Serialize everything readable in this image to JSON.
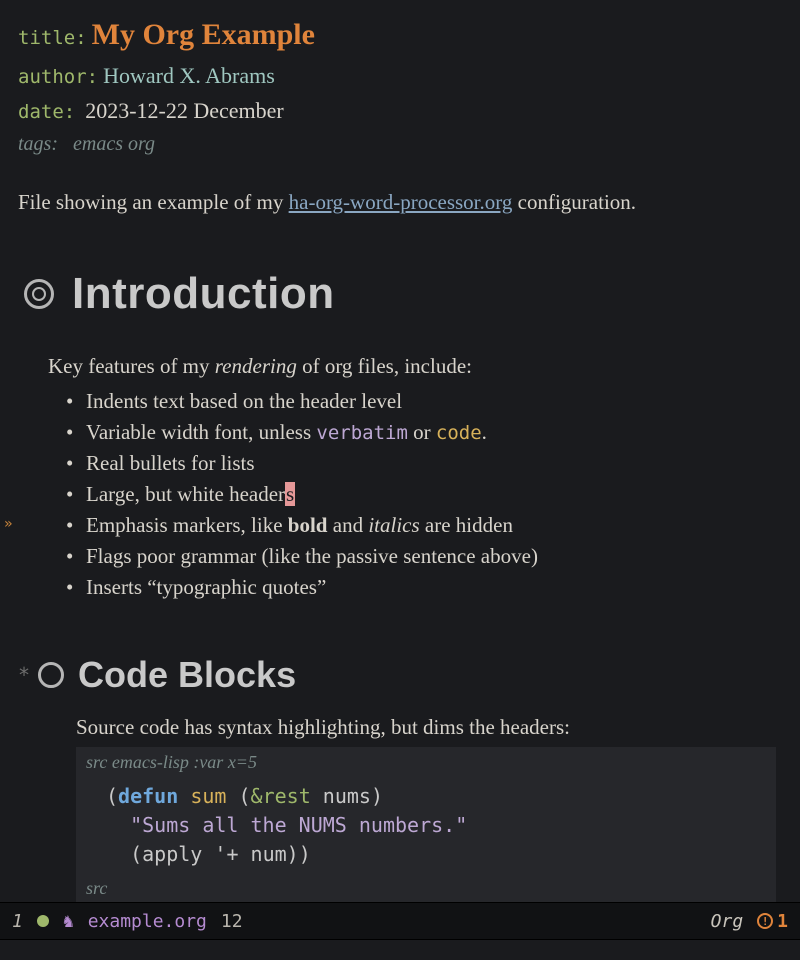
{
  "meta": {
    "title_key": "title",
    "title_val": "My Org Example",
    "author_key": "author",
    "author_val": "Howard X. Abrams",
    "date_key": "date",
    "date_val": "2023-12-22 December",
    "tags_key": "tags:",
    "tags_val": "emacs org"
  },
  "intro_para": {
    "pre": "File showing an example of my ",
    "link": "ha-org-word-processor.org",
    "post": " configuration."
  },
  "sections": {
    "h1": "Introduction",
    "keyline_pre": "Key features of my ",
    "keyline_em": "rendering",
    "keyline_post": " of org files, include:",
    "bullets": {
      "b0": "Indents text based on the header level",
      "b1_pre": "Variable width font, unless ",
      "b1_verb": "verbatim",
      "b1_mid": " or ",
      "b1_code": "code",
      "b1_post": ".",
      "b2": "Real bullets for lists",
      "b3_pre": "Large, but white header",
      "b3_cur": "s",
      "b4_pre": "Emphasis markers, like ",
      "b4_bold": "bold",
      "b4_mid": " and ",
      "b4_ital": "italics",
      "b4_post": " are hidden",
      "b5": "Flags poor grammar (like the passive sentence above)",
      "b6": "Inserts “typographic quotes”"
    },
    "h2_star": "*",
    "h2": "Code Blocks",
    "src_intro": "Source code has syntax highlighting, but dims the headers:",
    "src_header_pre": "src ",
    "src_header_lang": "emacs-lisp :var x=5",
    "src_footer": "src",
    "code": {
      "l1_open": "(",
      "l1_kw": "defun",
      "l1_sp1": " ",
      "l1_fn": "sum",
      "l1_sp2": " (",
      "l1_amp": "&rest",
      "l1_sp3": " ",
      "l1_arg": "nums",
      "l1_close": ")",
      "l2_indent": "  ",
      "l2_str": "\"Sums all the NUMS numbers.\"",
      "l3_indent": "  ",
      "l3_open": "(",
      "l3_fn": "apply",
      "l3_sp": " ",
      "l3_q": "'",
      "l3_plus": "+",
      "l3_sp2": " ",
      "l3_arg": "num",
      "l3_close": "))"
    }
  },
  "fringe_marker": "»",
  "modeline": {
    "left_num": "1",
    "unicorn": "♞",
    "filename": "example.org",
    "line": "12",
    "mode": "Org",
    "warn_count": "1",
    "warn_bang": "!"
  }
}
